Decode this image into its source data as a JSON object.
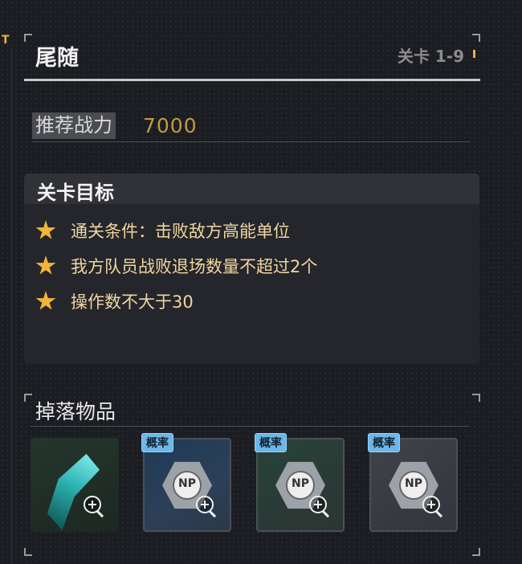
{
  "header": {
    "title": "尾随",
    "level": "关卡 1-9",
    "side_marker": "T"
  },
  "power": {
    "label": "推荐战力",
    "value": "7000"
  },
  "goals": {
    "title": "关卡目标",
    "items": [
      {
        "text": "通关条件：击败敌方高能单位"
      },
      {
        "text": "我方队员战败退场数量不超过2个"
      },
      {
        "text": "操作数不大于30"
      }
    ]
  },
  "drops": {
    "title": "掉落物品",
    "items": [
      {
        "badge": "",
        "icon": "crystal-icon",
        "np": ""
      },
      {
        "badge": "概率",
        "icon": "np-chip-icon",
        "np": "NP"
      },
      {
        "badge": "概率",
        "icon": "np-chip-icon",
        "np": "NP"
      },
      {
        "badge": "概率",
        "icon": "np-chip-icon",
        "np": "NP"
      }
    ]
  },
  "colors": {
    "accent": "#e7b43a",
    "goal_text": "#f0d6a0",
    "badge": "#6cb7ea",
    "power_value": "#c49a3c"
  }
}
